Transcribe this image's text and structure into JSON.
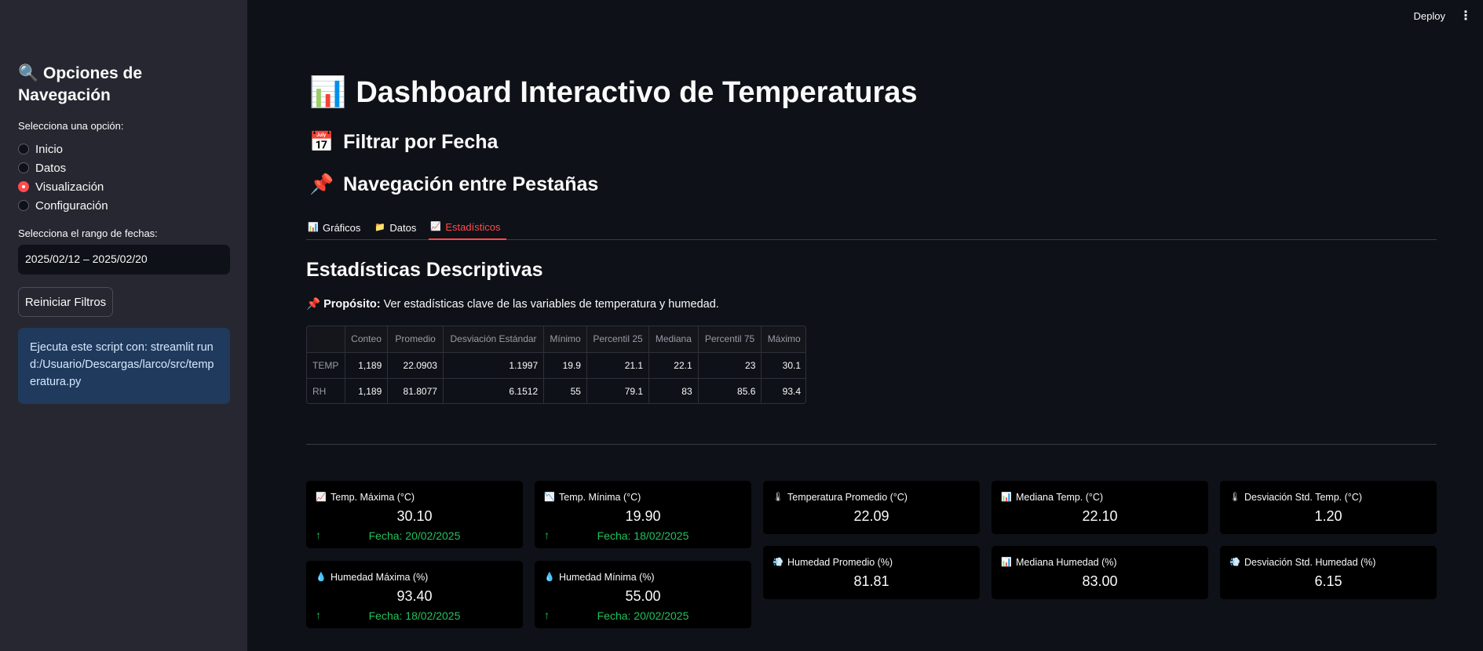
{
  "topbar": {
    "deploy": "Deploy",
    "menu": "⋮"
  },
  "sidebar": {
    "title_icon": "🔍",
    "title": "Opciones de Navegación",
    "radio_label": "Selecciona una opción:",
    "options": [
      "Inicio",
      "Datos",
      "Visualización",
      "Configuración"
    ],
    "selected": "Visualización",
    "date_label": "Selecciona el rango de fechas:",
    "date_value": "2025/02/12 – 2025/02/20",
    "reset_button": "Reiniciar Filtros",
    "info_text": "Ejecuta este script con: streamlit run d:/Usuario/Descargas/larco/src/temperatura.py"
  },
  "main": {
    "title_icon": "📊",
    "title": "Dashboard Interactivo de Temperaturas",
    "filter_icon": "📅",
    "filter_heading": "Filtrar por Fecha",
    "nav_icon": "📌",
    "nav_heading": "Navegación entre Pestañas",
    "tabs": [
      {
        "icon": "📊",
        "label": "Gráficos"
      },
      {
        "icon": "📁",
        "label": "Datos"
      },
      {
        "icon": "📈",
        "label": "Estadísticos"
      }
    ],
    "active_tab": "Estadísticos",
    "section_title": "Estadísticas Descriptivas",
    "purpose_icon": "📌",
    "purpose_bold": "Propósito:",
    "purpose_text": " Ver estadísticas clave de las variables de temperatura y humedad."
  },
  "table": {
    "columns": [
      "",
      "Conteo",
      "Promedio",
      "Desviación Estándar",
      "Mínimo",
      "Percentil 25",
      "Mediana",
      "Percentil 75",
      "Máximo"
    ],
    "rows": [
      [
        "TEMP",
        "1,189",
        "22.0903",
        "1.1997",
        "19.9",
        "21.1",
        "22.1",
        "23",
        "30.1"
      ],
      [
        "RH",
        "1,189",
        "81.8077",
        "6.1512",
        "55",
        "79.1",
        "83",
        "85.6",
        "93.4"
      ]
    ]
  },
  "metrics": {
    "temp_max": {
      "icon": "📈",
      "label": "Temp. Máxima (°C)",
      "value": "30.10",
      "delta": "Fecha: 20/02/2025"
    },
    "temp_min": {
      "icon": "📉",
      "label": "Temp. Mínima (°C)",
      "value": "19.90",
      "delta": "Fecha: 18/02/2025"
    },
    "temp_avg": {
      "icon": "🌡",
      "label": "Temperatura Promedio (°C)",
      "value": "22.09"
    },
    "temp_med": {
      "icon": "📊",
      "label": "Mediana Temp. (°C)",
      "value": "22.10"
    },
    "temp_std": {
      "icon": "🌡",
      "label": "Desviación Std. Temp. (°C)",
      "value": "1.20"
    },
    "hum_max": {
      "icon": "💧",
      "label": "Humedad Máxima (%)",
      "value": "93.40",
      "delta": "Fecha: 18/02/2025"
    },
    "hum_min": {
      "icon": "💧",
      "label": "Humedad Mínima (%)",
      "value": "55.00",
      "delta": "Fecha: 20/02/2025"
    },
    "hum_avg": {
      "icon": "💨",
      "label": "Humedad Promedio (%)",
      "value": "81.81"
    },
    "hum_med": {
      "icon": "📊",
      "label": "Mediana Humedad (%)",
      "value": "83.00"
    },
    "hum_std": {
      "icon": "💨",
      "label": "Desviación Std. Humedad (%)",
      "value": "6.15"
    },
    "delta_arrow": "↑"
  }
}
